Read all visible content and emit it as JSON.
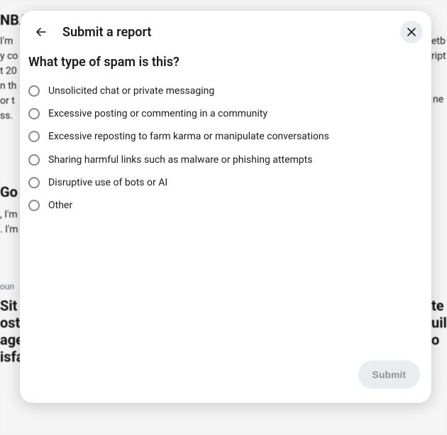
{
  "backdrop": {
    "heading1": "NBA",
    "body1": "I'm\ny co\nt 20\nn th\nor t\nss.",
    "body1_right": "etb\nript",
    "body1_right2": "ne",
    "heading2": "Go",
    "body2": ", I'm\n. I'm",
    "ad_badge": "oun",
    "heading3": "Sit\nost\nage\nisfa",
    "heading3_right": "te\nuil\no"
  },
  "modal": {
    "title": "Submit a report",
    "subtitle": "What type of spam is this?",
    "options": [
      {
        "label": "Unsolicited chat or private messaging"
      },
      {
        "label": "Excessive posting or commenting in a community"
      },
      {
        "label": "Excessive reposting to farm karma or manipulate conversations"
      },
      {
        "label": "Sharing harmful links such as malware or phishing attempts"
      },
      {
        "label": "Disruptive use of bots or AI"
      },
      {
        "label": "Other"
      }
    ],
    "submit_label": "Submit"
  }
}
